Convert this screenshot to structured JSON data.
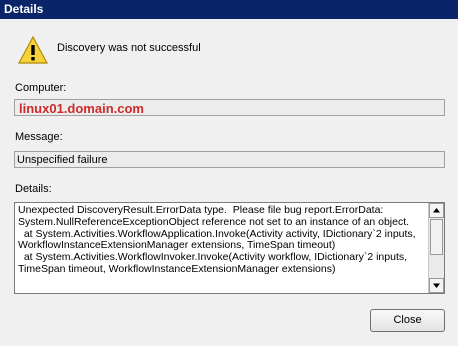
{
  "window": {
    "title": "Details"
  },
  "status": {
    "icon": "warning-icon",
    "message": "Discovery was not successful"
  },
  "computer": {
    "label": "Computer:",
    "value": "linux01.domain.com",
    "value_color": "#cc2a2a"
  },
  "message": {
    "label": "Message:",
    "value": "Unspecified failure"
  },
  "details": {
    "label": "Details:",
    "text": "Unexpected DiscoveryResult.ErrorData type.  Please file bug report.ErrorData: System.NullReferenceExceptionObject reference not set to an instance of an object.\n  at System.Activities.WorkflowApplication.Invoke(Activity activity, IDictionary`2 inputs, WorkflowInstanceExtensionManager extensions, TimeSpan timeout)\n  at System.Activities.WorkflowInvoker.Invoke(Activity workflow, IDictionary`2 inputs, TimeSpan timeout, WorkflowInstanceExtensionManager extensions)"
  },
  "buttons": {
    "close": "Close"
  }
}
